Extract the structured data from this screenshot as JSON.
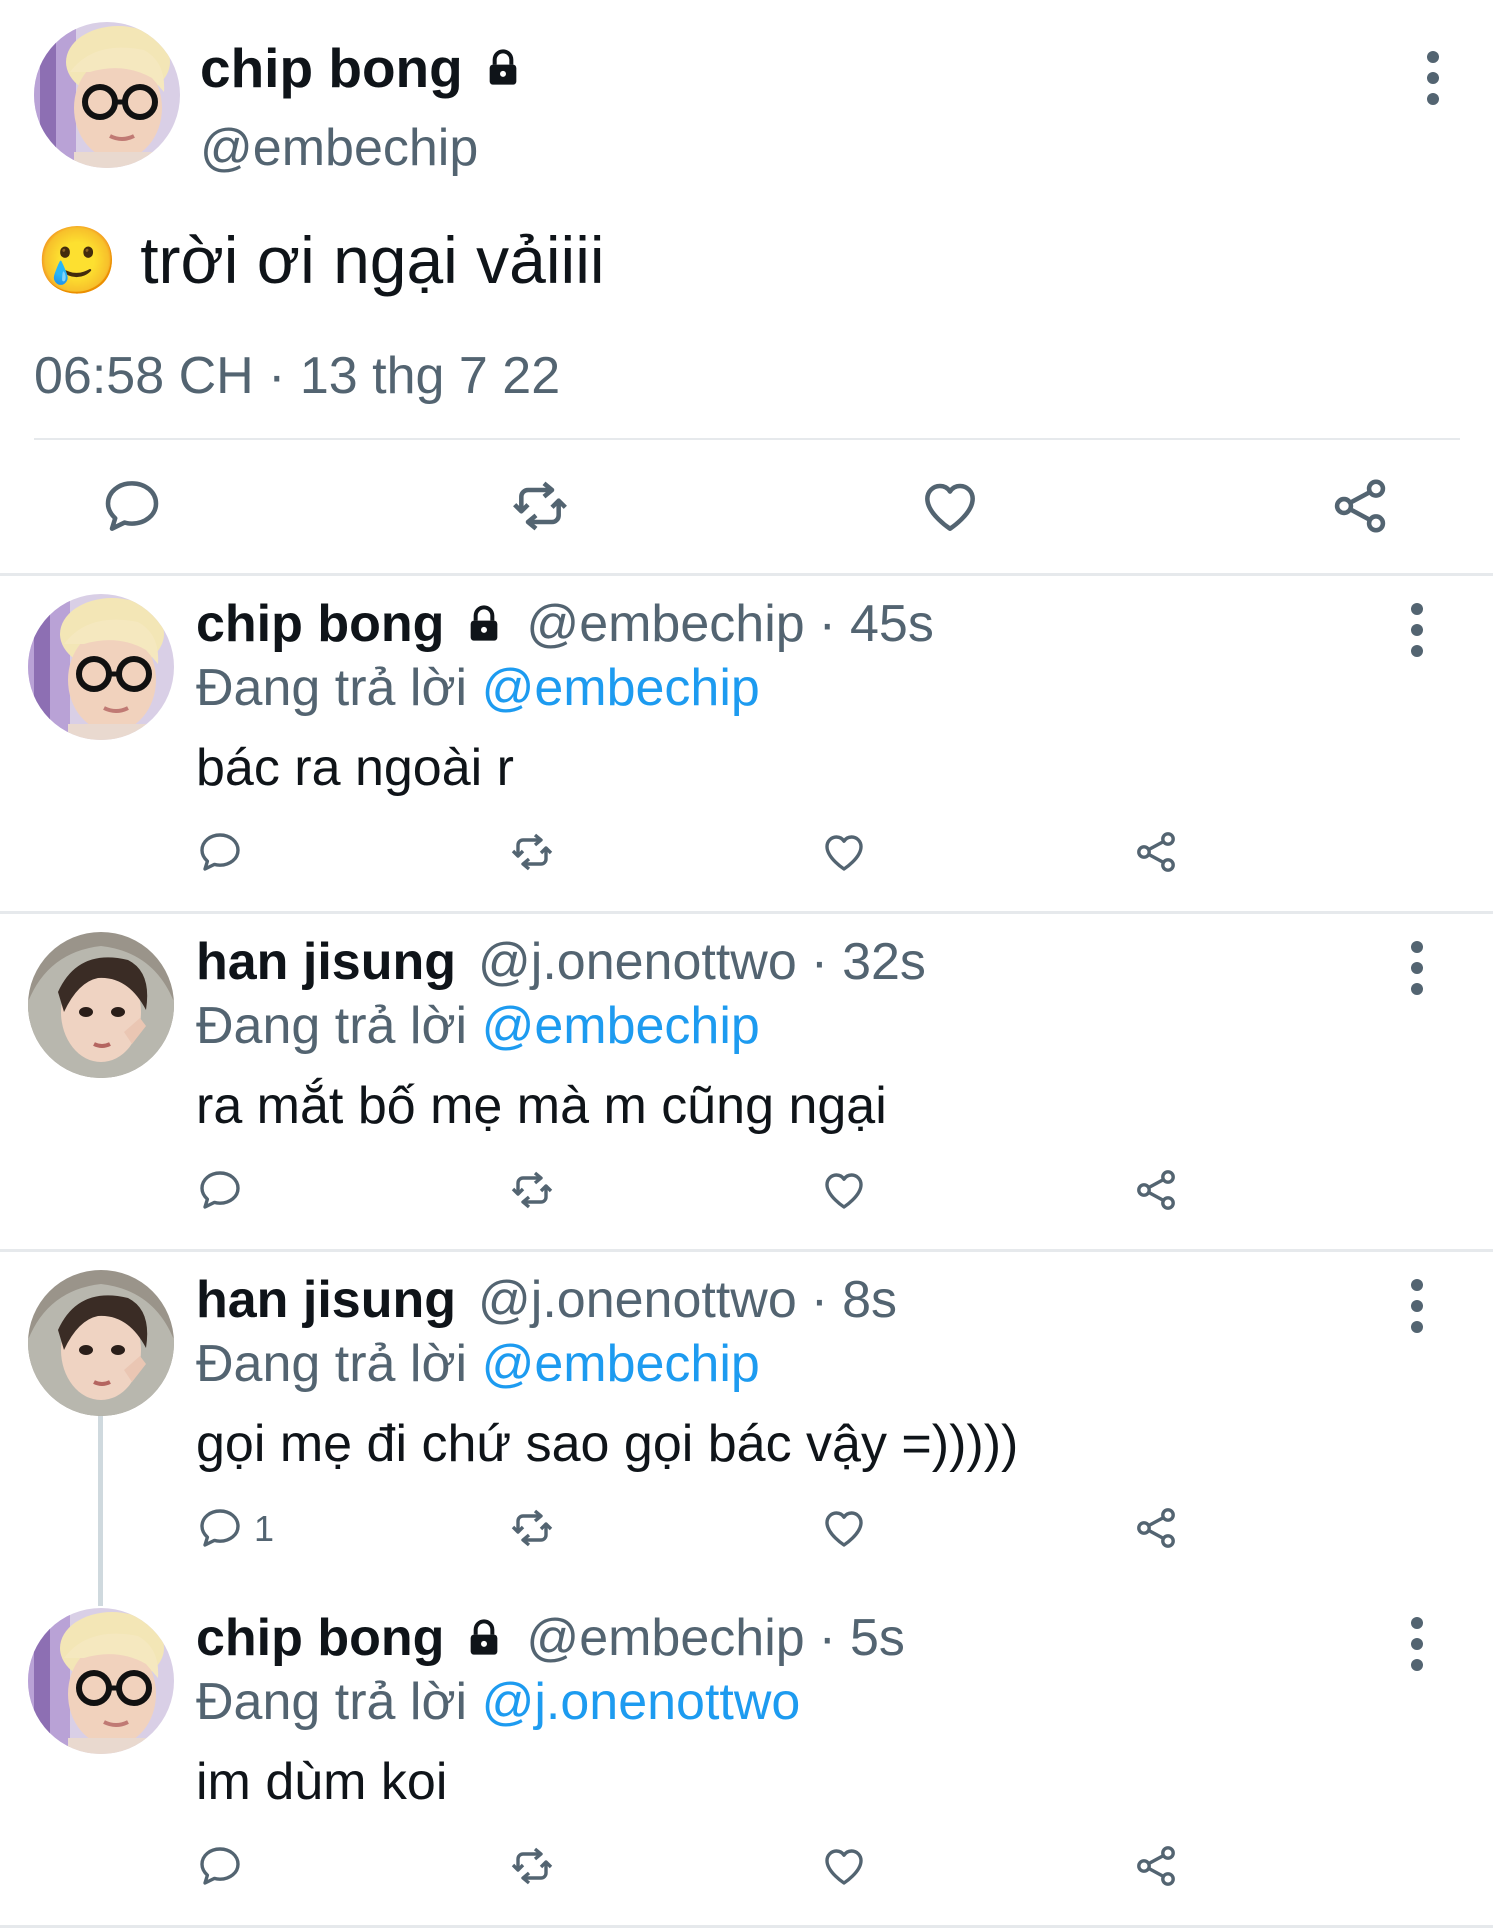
{
  "main_tweet": {
    "name": "chip bong",
    "handle": "@embechip",
    "emoji": "🥲",
    "text": "trời ơi ngại vảiiii",
    "timestamp": "06:58 CH · 13 thg 7 22",
    "locked": true,
    "avatar": "avatar-blonde-glasses",
    "actions": [
      "reply-icon",
      "retweet-icon",
      "like-icon",
      "share-icon"
    ]
  },
  "replies": [
    {
      "name": "chip bong",
      "handle": "@embechip",
      "age": "45s",
      "locked": true,
      "avatar": "avatar-blonde-glasses",
      "replying_prefix": "Đang trả lời",
      "replying_to": "@embechip",
      "text": "bác ra ngoài r",
      "reply_count": ""
    },
    {
      "name": "han jisung",
      "handle": "@j.onenottwo",
      "age": "32s",
      "locked": false,
      "avatar": "avatar-hoodie",
      "replying_prefix": "Đang trả lời",
      "replying_to": "@embechip",
      "text": "ra mắt bố mẹ mà m cũng ngại",
      "reply_count": ""
    },
    {
      "name": "han jisung",
      "handle": "@j.onenottwo",
      "age": "8s",
      "locked": false,
      "avatar": "avatar-hoodie",
      "replying_prefix": "Đang trả lời",
      "replying_to": "@embechip",
      "text": "gọi mẹ đi chứ sao gọi bác vậy =)))))",
      "reply_count": "1"
    },
    {
      "name": "chip bong",
      "handle": "@embechip",
      "age": "5s",
      "locked": true,
      "avatar": "avatar-blonde-glasses",
      "replying_prefix": "Đang trả lời",
      "replying_to": "@j.onenottwo",
      "text": "im dùm koi",
      "reply_count": ""
    }
  ],
  "colors": {
    "text": "#0f1419",
    "secondary": "#536471",
    "link": "#1d9bf0",
    "divider": "#e6e9ec"
  }
}
